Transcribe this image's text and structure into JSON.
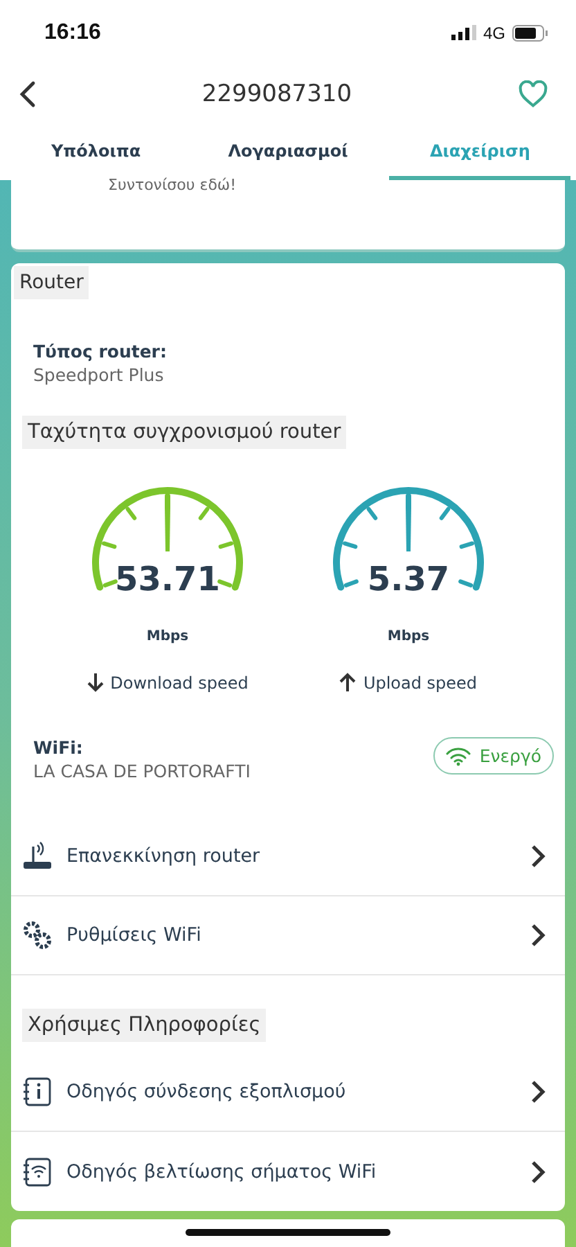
{
  "status_bar": {
    "time": "16:16",
    "network": "4G"
  },
  "header": {
    "title": "2299087310",
    "favorite": false
  },
  "tabs": [
    {
      "label": "Υπόλοιπα",
      "selected": false
    },
    {
      "label": "Λογαριασμοί",
      "selected": false
    },
    {
      "label": "Διαχείριση",
      "selected": true
    }
  ],
  "previous_card": {
    "text": "Συντονίσου εδώ!"
  },
  "router_card": {
    "title": "Router",
    "type_label": "Τύπος router:",
    "type_value": "Speedport Plus",
    "speed_heading": "Ταχύτητα συγχρονισμού router",
    "gauges": [
      {
        "value": "53.71",
        "unit": "Mbps",
        "label": "Download speed",
        "kind": "down",
        "color": "#7cc52c"
      },
      {
        "value": "5.37",
        "unit": "Mbps",
        "label": "Upload speed",
        "kind": "up",
        "color": "#2ba3b3"
      }
    ],
    "wifi_label": "WiFi:",
    "wifi_name": "LA CASA DE PORTORAFTI",
    "wifi_status": {
      "label": "Ενεργό",
      "active": true
    },
    "actions": [
      {
        "label": "Επανεκκίνηση router",
        "kind": "router"
      },
      {
        "label": "Ρυθμίσεις WiFi",
        "kind": "gears"
      }
    ],
    "info_heading": "Χρήσιμες Πληροφορίες",
    "guides": [
      {
        "label": "Οδηγός σύνδεσης εξοπλισμού",
        "kind": "info"
      },
      {
        "label": "Οδηγός βελτίωσης σήματος WiFi",
        "kind": "wifi"
      }
    ]
  }
}
